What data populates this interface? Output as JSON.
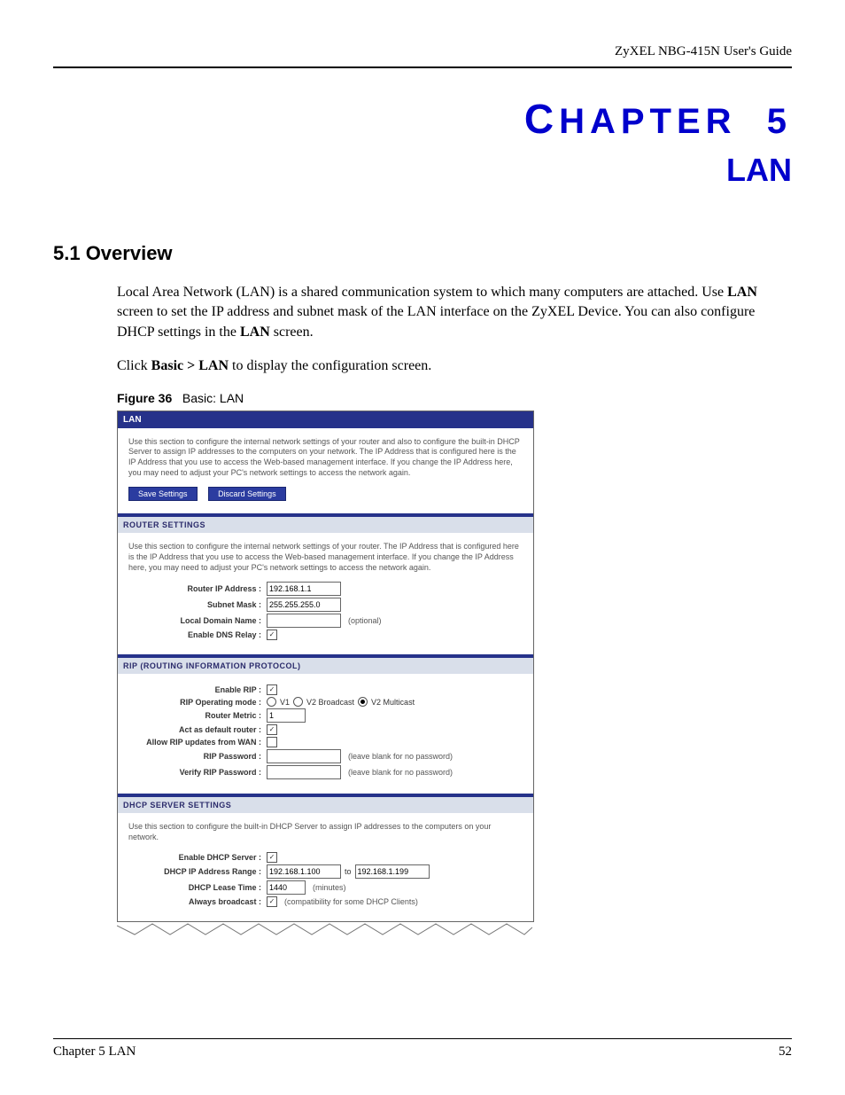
{
  "header": {
    "title": "ZyXEL NBG-415N User's Guide"
  },
  "chapter": {
    "word": "HAPTER",
    "num": "5",
    "sub": "LAN"
  },
  "section": {
    "heading": "5.1  Overview",
    "p1_a": "Local Area Network (LAN) is a shared communication system to which many computers are attached. Use ",
    "p1_b": "LAN",
    "p1_c": " screen to set the IP address and subnet mask of the LAN interface on the ZyXEL Device. You can also configure DHCP settings in the ",
    "p1_d": "LAN",
    "p1_e": " screen.",
    "p2_a": "Click ",
    "p2_b": "Basic > LAN",
    "p2_c": " to display the configuration screen."
  },
  "figure": {
    "label": "Figure 36",
    "caption": "Basic: LAN"
  },
  "lan": {
    "title": "LAN",
    "intro": "Use this section to configure the internal network settings of your router and also to configure the built-in DHCP Server to assign IP addresses to the computers on your network. The IP Address that is configured here is the IP Address that you use to access the Web-based management interface. If you change the IP Address here, you may need to adjust your PC's network settings to access the network again.",
    "save": "Save Settings",
    "discard": "Discard Settings",
    "router": {
      "title": "ROUTER SETTINGS",
      "desc": "Use this section to configure the internal network settings of your router. The IP Address that is configured here is the IP Address that you use to access the Web-based management interface. If you change the IP Address here, you may need to adjust your PC's network settings to access the network again.",
      "ip_label": "Router IP Address :",
      "ip": "192.168.1.1",
      "mask_label": "Subnet Mask :",
      "mask": "255.255.255.0",
      "domain_label": "Local Domain Name :",
      "domain": "",
      "optional": "(optional)",
      "dns_label": "Enable DNS Relay :"
    },
    "rip": {
      "title": "RIP (ROUTING INFORMATION PROTOCOL)",
      "enable_label": "Enable RIP :",
      "mode_label": "RIP Operating mode :",
      "v1": "V1",
      "v2b": "V2 Broadcast",
      "v2m": "V2 Multicast",
      "metric_label": "Router Metric :",
      "metric": "1",
      "default_label": "Act as default router :",
      "wan_label": "Allow RIP updates from WAN :",
      "pw_label": "RIP Password :",
      "pw_hint": "(leave blank for no password)",
      "vpw_label": "Verify RIP Password :"
    },
    "dhcp": {
      "title": "DHCP SERVER SETTINGS",
      "desc": "Use this section to configure the built-in DHCP Server to assign IP addresses to the computers on your network.",
      "enable_label": "Enable DHCP Server :",
      "range_label": "DHCP IP Address Range :",
      "from": "192.168.1.100",
      "to_word": "to",
      "to": "192.168.1.199",
      "lease_label": "DHCP Lease Time :",
      "lease": "1440",
      "minutes": "(minutes)",
      "bcast_label": "Always broadcast :",
      "bcast_hint": "(compatibility for some DHCP Clients)"
    }
  },
  "footer": {
    "left": "Chapter 5 LAN",
    "right": "52"
  }
}
